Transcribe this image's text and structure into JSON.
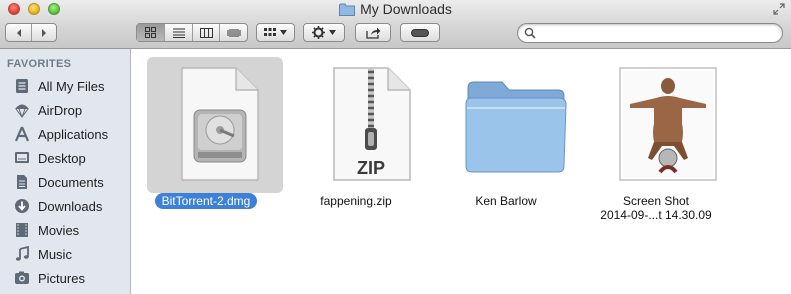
{
  "window": {
    "title": "My Downloads"
  },
  "toolbar": {
    "back_icon": "chevron-left-icon",
    "forward_icon": "chevron-right-icon",
    "view_modes": [
      "icon-view",
      "list-view",
      "column-view",
      "coverflow-view"
    ],
    "active_view": "icon-view",
    "arrange_icon": "arrange-grid-icon",
    "action_icon": "gear-icon",
    "share_icon": "share-icon",
    "toggle_icon": "toggle-pill-icon"
  },
  "search": {
    "value": "",
    "placeholder": ""
  },
  "sidebar": {
    "header": "FAVORITES",
    "items": [
      {
        "label": "All My Files",
        "icon": "all-files-icon"
      },
      {
        "label": "AirDrop",
        "icon": "airdrop-icon"
      },
      {
        "label": "Applications",
        "icon": "applications-icon"
      },
      {
        "label": "Desktop",
        "icon": "desktop-icon"
      },
      {
        "label": "Documents",
        "icon": "documents-icon"
      },
      {
        "label": "Downloads",
        "icon": "downloads-icon"
      },
      {
        "label": "Movies",
        "icon": "movies-icon"
      },
      {
        "label": "Music",
        "icon": "music-icon"
      },
      {
        "label": "Pictures",
        "icon": "pictures-icon"
      }
    ]
  },
  "files": [
    {
      "name": "BitTorrent-2.dmg",
      "name_line2": "",
      "icon": "disk-image-icon",
      "selected": true
    },
    {
      "name": "fappening.zip",
      "name_line2": "",
      "icon": "zip-archive-icon",
      "selected": false
    },
    {
      "name": "Ken Barlow",
      "name_line2": "",
      "icon": "folder-icon",
      "selected": false
    },
    {
      "name": "Screen Shot",
      "name_line2": "2014-09-...t 14.30.09",
      "icon": "screenshot-thumbnail-icon",
      "selected": false
    }
  ],
  "zip_label": "ZIP",
  "colors": {
    "selection": "#3d80d8",
    "sidebar_bg": "#e2e7ee",
    "folder": "#8ab6e0"
  }
}
